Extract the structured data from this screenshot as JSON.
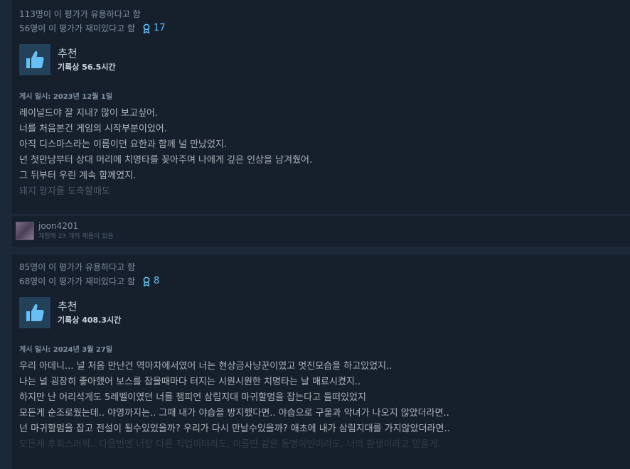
{
  "reviews": [
    {
      "helpful": "113명이 이 평가가 유용하다고 함",
      "funny": "56명이 이 평가가 재미있다고 함",
      "award_count": "17",
      "recommendation": "추천",
      "hours": "기록상 56.5시간",
      "posted": "게시 일시: 2023년 12월 1일",
      "lines": [
        "레이널드야 잘 지내? 많이 보고싶어.",
        "너를 처음본건 게임의 시작부분이었어.",
        "아직 디스마스라는 이름이던 요한과 함께 널 만났었지.",
        "넌 첫만남부터 상대 머리에 치명타를 꽂아주며 나에게 깊은 인상을 남겨줬어.",
        "그 뒤부터 우린 계속 함께였지.",
        "돼지 왕자를 도축할때도"
      ],
      "author_name": "joon4201",
      "author_products": "계정에 23 개의 제품이 있음"
    },
    {
      "helpful": "85명이 이 평가가 유용하다고 함",
      "funny": "68명이 이 평가가 재미있다고 함",
      "award_count": "8",
      "recommendation": "추천",
      "hours": "기록상 408.3시간",
      "posted": "게시 일시: 2024년 3월 27일",
      "lines": [
        "우리 아데니... 널 처음 만난건 역마차에서였어 너는 현상금사냥꾼이였고 멋진모습을 하고있었지..",
        "나는 널 굉장히 좋아했어 보스를 잡을때마다 터지는 시원시원한 치명타는 날 매료시켰지..",
        "하지만 난 어리석게도 5레벨이였던 너를 챔피언 삼림지대 마귀할멈을 잡는다고 들떠있었지",
        "모든게 순조로웠는데.. 야영까지는.. 그때 내가 야습을 방지했다면.. 야습으로 구울과 악녀가 나오지 않았더라면..",
        "넌 마귀할멈을 잡고 전설이 될수있었을까? 우리가 다시 만날수있을까? 애초에 내가 삼림지대를 가지않았더라면..",
        "모든게 후회스러워.. 다음번엔 너랑 다른 직업이더라도, 이름만 같은 동명이인이라도, 너의 환생이라고 믿을게."
      ]
    }
  ],
  "colors": {
    "background": "#1b2838",
    "card": "#16202d",
    "accent": "#66c0f4",
    "muted": "#8091a2",
    "text": "#acb2b8"
  },
  "icons": {
    "award": "award-ribbon-icon",
    "recommend": "thumbs-up-icon"
  }
}
